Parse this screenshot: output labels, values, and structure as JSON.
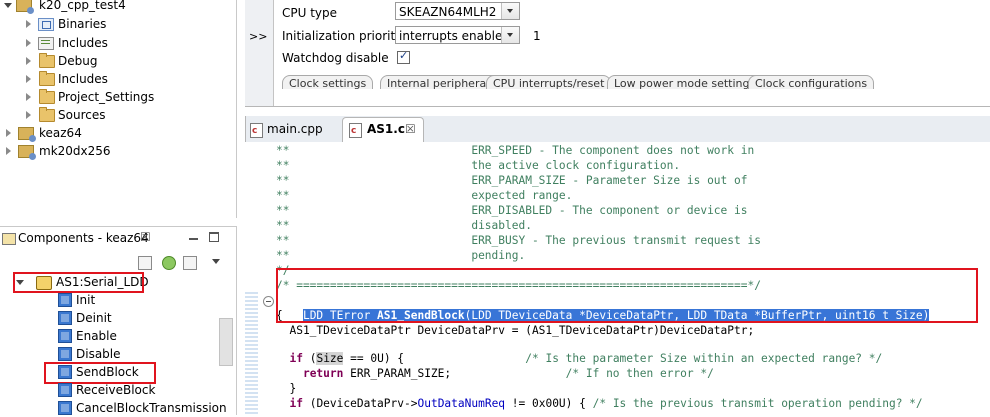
{
  "project_tree": {
    "items": [
      {
        "label": "k20_cpp_test4",
        "icon": "project-icon",
        "expanded": true
      },
      {
        "label": "Binaries",
        "icon": "binaries-icon"
      },
      {
        "label": "Includes",
        "icon": "includes-icon"
      },
      {
        "label": "Debug",
        "icon": "folder-icon"
      },
      {
        "label": "Includes",
        "icon": "folder-icon"
      },
      {
        "label": "Project_Settings",
        "icon": "folder-icon"
      },
      {
        "label": "Sources",
        "icon": "folder-icon"
      },
      {
        "label": "keaz64",
        "icon": "project-icon"
      },
      {
        "label": "mk20dx256",
        "icon": "project-icon"
      }
    ]
  },
  "components_panel": {
    "title": "Components - keaz64",
    "close_glyph": "☒",
    "root": "AS1:Serial_LDD",
    "methods": [
      "Init",
      "Deinit",
      "Enable",
      "Disable",
      "SendBlock",
      "ReceiveBlock",
      "CancelBlockTransmission"
    ]
  },
  "properties": {
    "expand_glyph": ">>",
    "cpu_type_label": "CPU type",
    "cpu_type_value": "SKEAZN64MLH2",
    "init_priority_label": "Initialization priority",
    "init_priority_value": "interrupts enabled",
    "init_priority_extra": "1",
    "watchdog_label": "Watchdog disable",
    "watchdog_checked": "✓",
    "tabs": [
      "Clock settings",
      "Internal peripherals",
      "CPU interrupts/reset",
      "Low power mode settings",
      "Clock configurations"
    ]
  },
  "editor": {
    "tabs": [
      {
        "label": "main.cpp",
        "active": false
      },
      {
        "label": "AS1.c",
        "active": true,
        "close": "☒"
      }
    ],
    "lines": {
      "c1": "**                           ERR_SPEED - The component does not work in",
      "c2": "**                           the active clock configuration.",
      "c3": "**                           ERR_PARAM_SIZE - Parameter Size is out of",
      "c4": "**                           expected range.",
      "c5": "**                           ERR_DISABLED - The component or device is",
      "c6": "**                           disabled.",
      "c7": "**                           ERR_BUSY - The previous transmit request is",
      "c8": "**                           pending.",
      "c9": "*/",
      "c10": "/* ===================================================================*/",
      "sig_type": "LDD_TError ",
      "sig_name": "AS1_SendBlock",
      "sig_args": "(LDD_TDeviceData *DeviceDataPtr, LDD_TData *BufferPtr, uint16_t Size)",
      "brace_open": "{",
      "decl": "  AS1_TDeviceDataPtr DeviceDataPrv = (AS1_TDeviceDataPtr)DeviceDataPtr;",
      "if1_kw": "if",
      "if1_rest_a": " (",
      "if1_size": "Size",
      "if1_rest_b": " == 0U) {                  ",
      "if1_cm": "/* Is the parameter Size within an expected range? */",
      "ret_kw": "return",
      "ret_rest": " ERR_PARAM_SIZE;                 ",
      "ret_cm": "/* If no then error */",
      "brace_close": "  }",
      "if2_kw": "if",
      "if2_rest_a": " (DeviceDataPrv->",
      "if2_field": "OutDataNumReq",
      "if2_rest_b": " != 0x00U) { ",
      "if2_cm": "/* Is the previous transmit operation pending? */"
    }
  }
}
